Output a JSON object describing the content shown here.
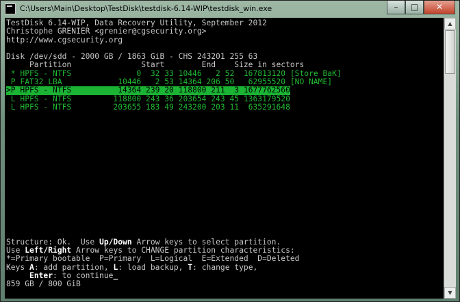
{
  "window": {
    "title": "C:\\Users\\Main\\Desktop\\TestDisk\\testdisk-6.14-WIP\\testdisk_win.exe",
    "icon": "console-icon",
    "buttons": {
      "minimize": "–",
      "maximize": "□",
      "close": "✕"
    }
  },
  "console": {
    "header": [
      "TestDisk 6.14-WIP, Data Recovery Utility, September 2012",
      "Christophe GRENIER <grenier@cgsecurity.org>",
      "http://www.cgsecurity.org"
    ],
    "disk": "Disk /dev/sdd - 2000 GB / 1863 GiB - CHS 243201 255 63",
    "columns": "     Partition               Start        End    Size in sectors",
    "partitions": [
      " * HPFS - NTFS              0  32 33 10446   2 52  167813120 [Store BaK]",
      " P FAT32 LBA            10446   2 53 14364 206 50   62955520 [NO NAME]",
      ">P HPFS - NTFS          14364 239 20 118800 211  3 1677762560",
      " L HPFS - NTFS         118800 243 36 203654 243 45 1363179520",
      " L HPFS - NTFS         203655 183 49 243200 203 11  635291648"
    ],
    "selected_index": 2,
    "footer": {
      "l1_a": "Structure: Ok.  Use ",
      "l1_b": "Up/Down",
      "l1_c": " Arrow keys to select partition.",
      "l2_a": "Use ",
      "l2_b": "Left/Right",
      "l2_c": " Arrow keys to CHANGE partition characteristics:",
      "l3": "*=Primary bootable  P=Primary  L=Logical  E=Extended  D=Deleted",
      "l4_a": "Keys ",
      "l4_b": "A",
      "l4_c": ": add partition, ",
      "l4_d": "L",
      "l4_e": ": load backup, ",
      "l4_f": "T",
      "l4_g": ": change type,",
      "l5_a": "     ",
      "l5_b": "Enter",
      "l5_c": ": to continue",
      "l5_cursor": "_",
      "l6": "859 GB / 800 GiB"
    }
  },
  "colors": {
    "console_bg": "#000000",
    "text_default": "#c7c7c7",
    "partition_green": "#21b832",
    "selection_bg": "#1bb334"
  }
}
